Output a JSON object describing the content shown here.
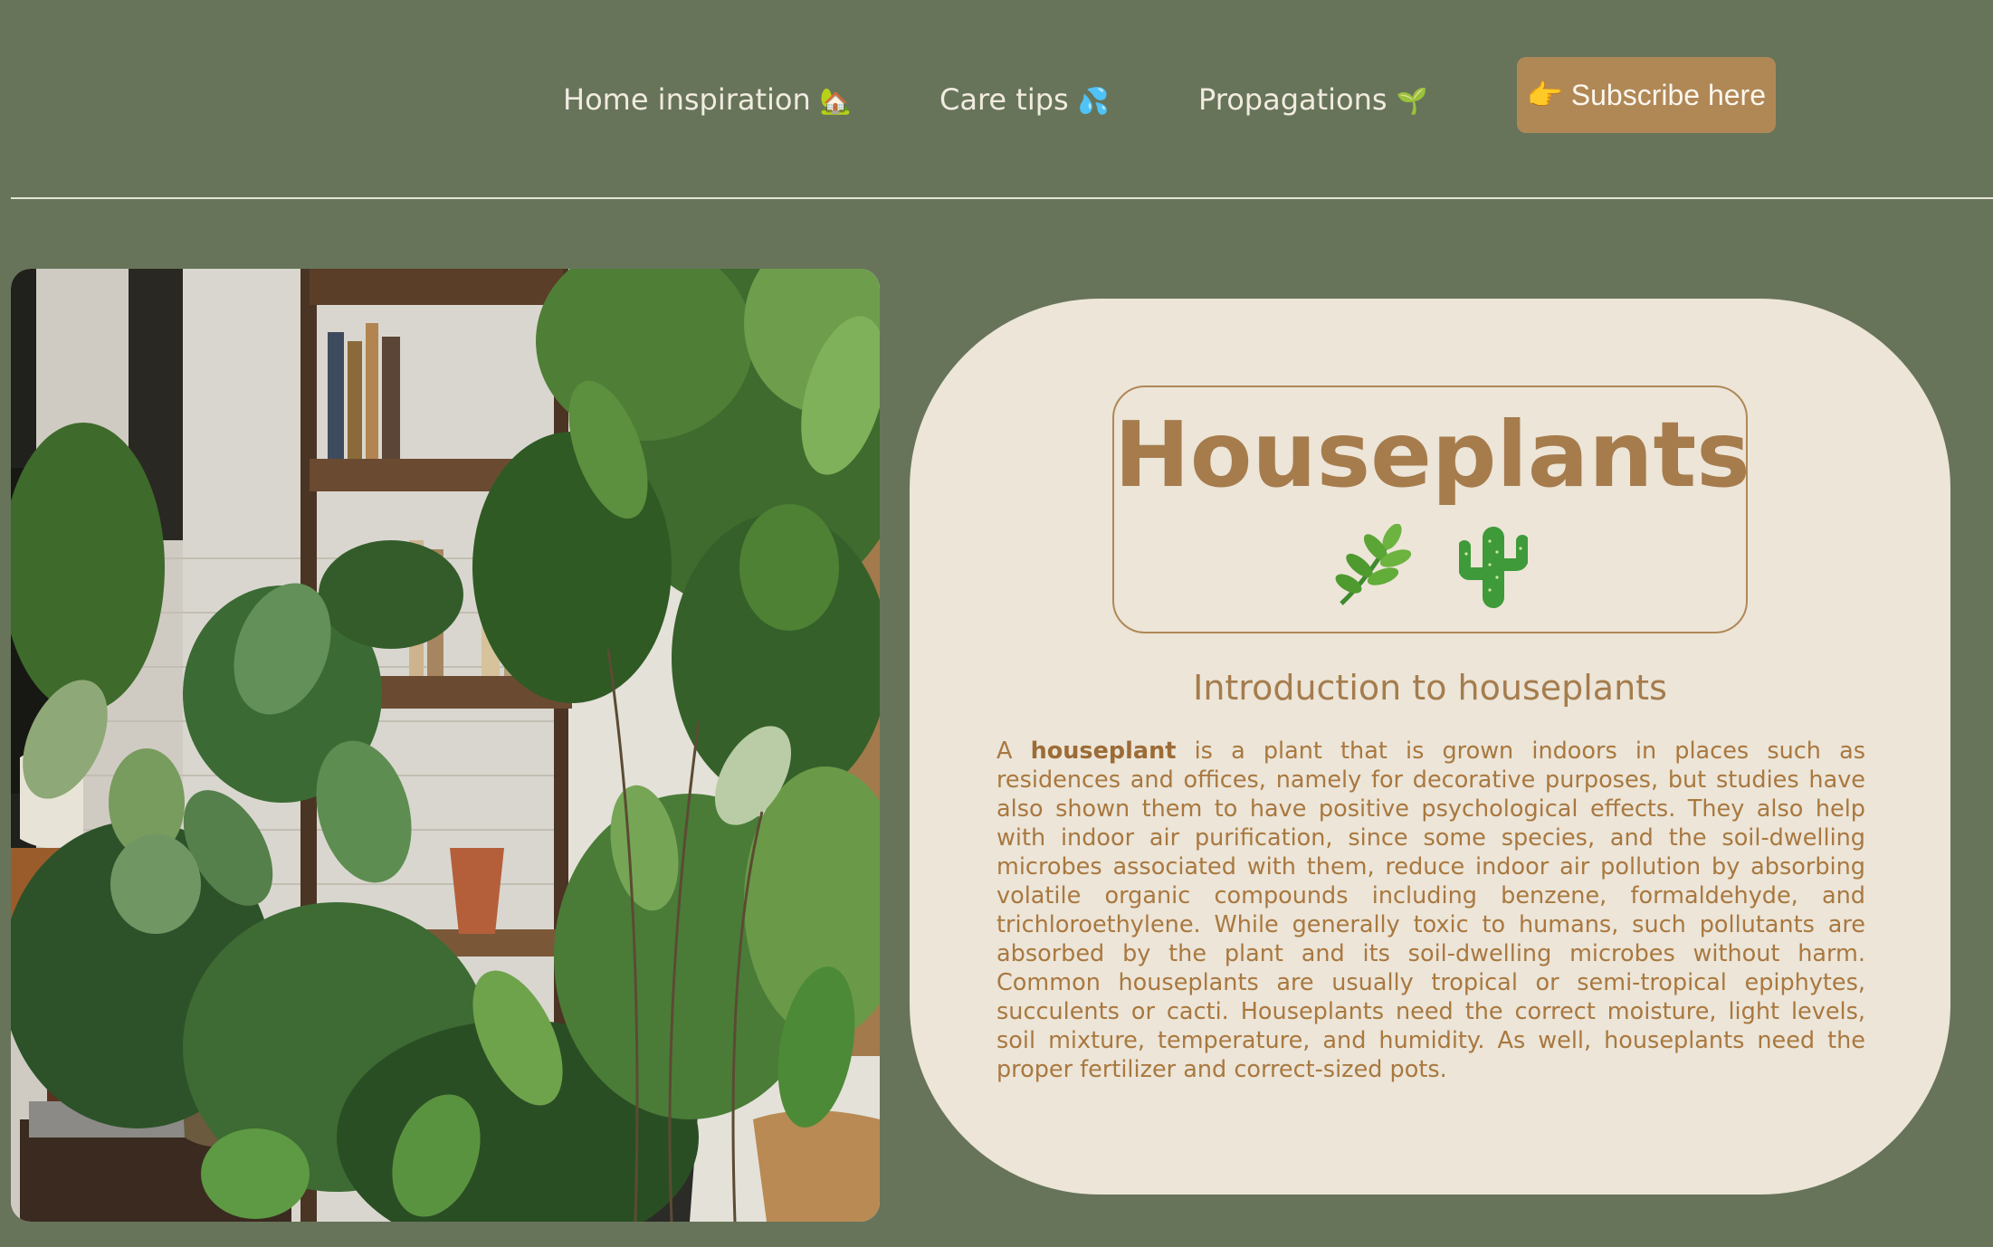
{
  "nav": {
    "links": [
      {
        "label": "Home inspiration",
        "emoji": "🏡"
      },
      {
        "label": "Care tips",
        "emoji": "💦"
      },
      {
        "label": "Propagations",
        "emoji": "🌱"
      }
    ],
    "subscribe_label": "👉 Subscribe here"
  },
  "hero": {
    "icons": [
      "herb-icon",
      "cactus-icon"
    ]
  },
  "card": {
    "title": "Houseplants",
    "subtitle": "Introduction to houseplants",
    "intro_lead": "A",
    "intro_bold": "houseplant",
    "intro_rest": "is a plant that is grown indoors in places such as residences and offices, namely for decorative purposes, but studies have also shown them to have positive psychological effects. They also help with indoor air purification, since some species, and the soil-dwelling microbes associated with them, reduce indoor air pollution by absorbing volatile organic compounds including benzene, formaldehyde, and trichloroethylene. While generally toxic to humans, such pollutants are absorbed by the plant and its soil-dwelling microbes without harm. Common houseplants are usually tropical or semi-tropical epiphytes, succulents or cacti. Houseplants need the correct moisture, light levels, soil mixture, temperature, and humidity. As well, houseplants need the proper fertilizer and correct-sized pots."
  },
  "colors": {
    "background": "#67745a",
    "card": "#ece5d8",
    "accent": "#b08856",
    "nav_text": "#f1ebe0"
  }
}
